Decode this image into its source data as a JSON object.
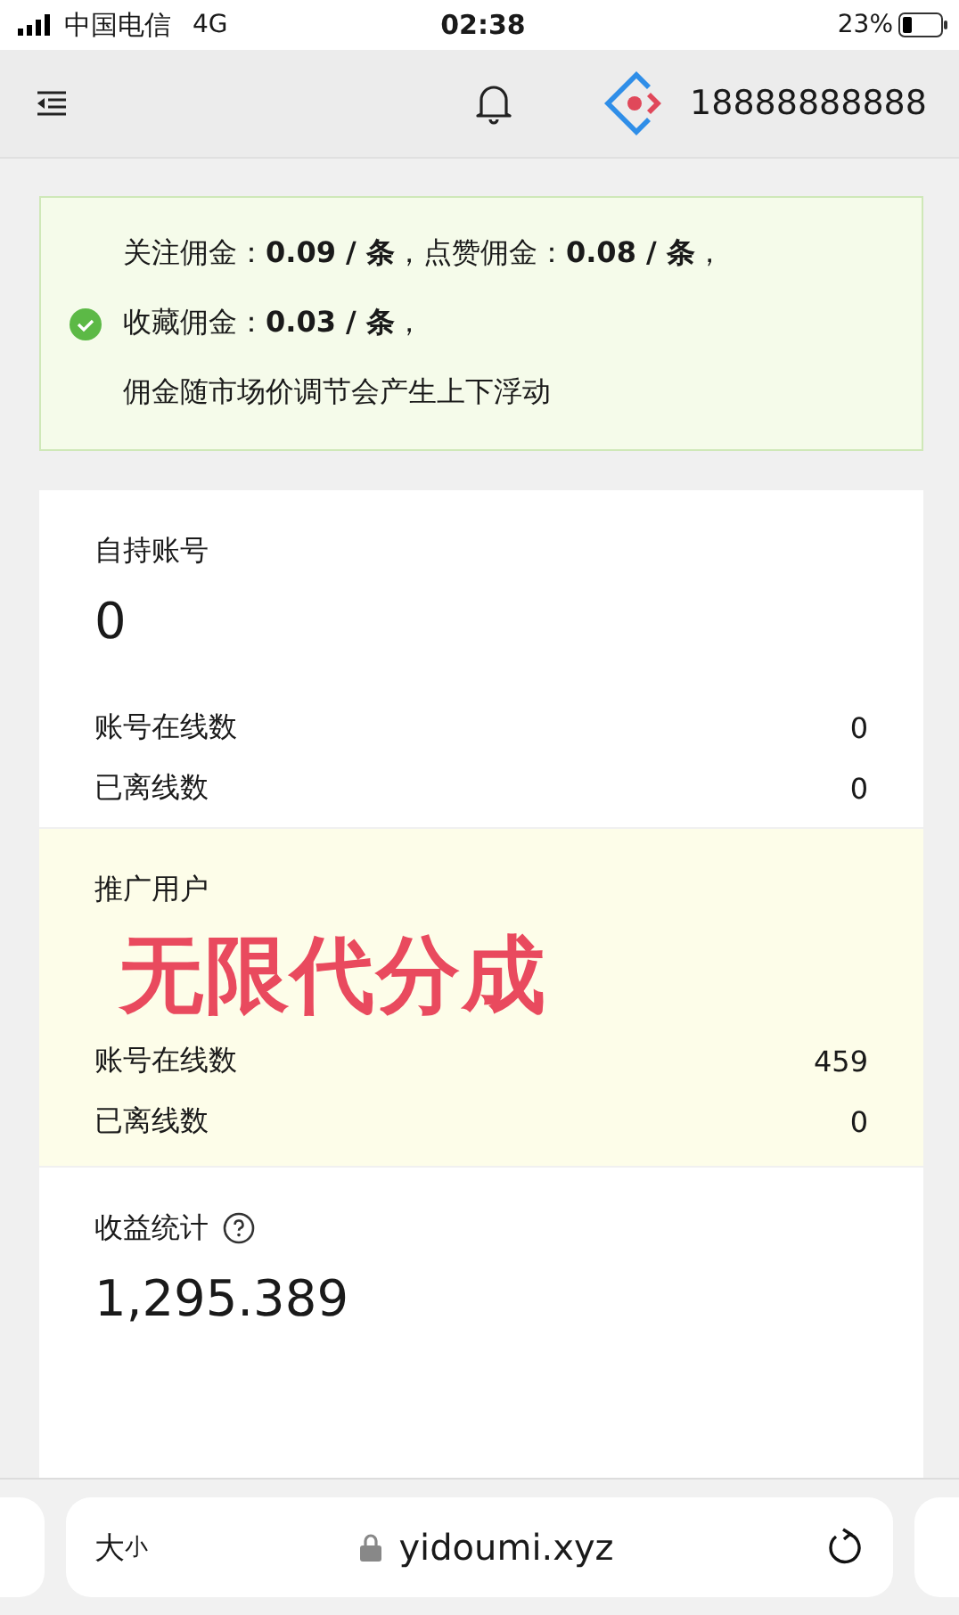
{
  "status_bar": {
    "carrier": "中国电信",
    "network": "4G",
    "time": "02:38",
    "battery": "23%"
  },
  "header": {
    "account": "18888888888"
  },
  "notice": {
    "lines": [
      "关注佣金：**0.09 / 条** ，点赞佣金：**0.08 / 条** ，",
      "收藏佣金：**0.03 / 条** ，",
      "佣金随市场价调节会产生上下浮动"
    ]
  },
  "cards": [
    {
      "title": "自持账号",
      "value": "0",
      "highlighted": false,
      "help": false,
      "rows": [
        {
          "label": "账号在线数",
          "value": "0"
        },
        {
          "label": "已离线数",
          "value": "0"
        }
      ]
    },
    {
      "title": "推广用户",
      "overlay": "无限代分成",
      "highlighted": true,
      "help": false,
      "rows": [
        {
          "label": "账号在线数",
          "value": "459"
        },
        {
          "label": "已离线数",
          "value": "0"
        }
      ]
    },
    {
      "title": "收益统计",
      "value": "1,295.389",
      "highlighted": false,
      "help": true
    }
  ],
  "browser_bar": {
    "text_size": {
      "large": "大",
      "small": "小"
    },
    "url": "yidoumi.xyz"
  }
}
